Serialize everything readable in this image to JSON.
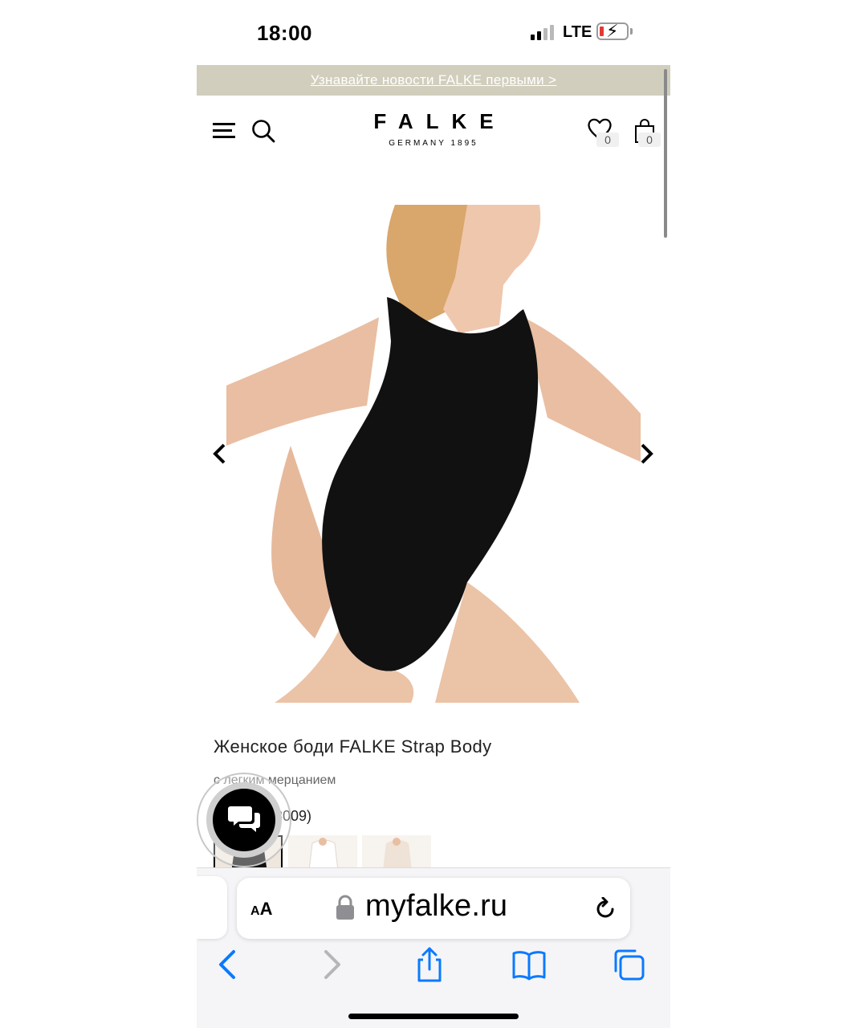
{
  "status_bar": {
    "time": "18:00",
    "network": "LTE",
    "battery_level": 0.15
  },
  "promo": {
    "text": "Узнавайте новости FALKE первыми >"
  },
  "header": {
    "logo": "FALKE",
    "logo_sub": "GERMANY 1895",
    "wishlist_count": "0",
    "bag_count": "0"
  },
  "product": {
    "title": "Женское боди FALKE Strap Body",
    "subtitle": "с легким мерцанием",
    "color_label": "Черный (3009)",
    "image_icon": "product-photo-black-bodysuit"
  },
  "browser": {
    "aa_label_small": "A",
    "aa_label_large": "A",
    "url": "myfalke.ru"
  },
  "colors": {
    "promo_bg": "#d1cebd",
    "safari_blue": "#0a7aff",
    "skin": "#e9bea2",
    "bodysuit": "#111111"
  }
}
